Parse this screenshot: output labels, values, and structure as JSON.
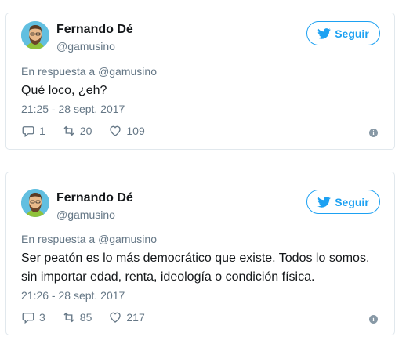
{
  "tweets": [
    {
      "author_name": "Fernando Dé",
      "author_handle": "@gamusino",
      "follow_label": "Seguir",
      "reply_prefix": "En respuesta a",
      "reply_handle": "@gamusino",
      "text": "Qué loco, ¿eh?",
      "timestamp": "21:25 - 28 sept. 2017",
      "replies": "1",
      "retweets": "20",
      "likes": "109"
    },
    {
      "author_name": "Fernando Dé",
      "author_handle": "@gamusino",
      "follow_label": "Seguir",
      "reply_prefix": "En respuesta a",
      "reply_handle": "@gamusino",
      "text": "Ser peatón es lo más democrático que existe. Todos lo somos, sin importar edad, renta, ideología o condición física.",
      "timestamp": "21:26 - 28 sept. 2017",
      "replies": "3",
      "retweets": "85",
      "likes": "217"
    }
  ],
  "colors": {
    "accent": "#1da1f2",
    "muted": "#657786",
    "border": "#e1e8ed"
  },
  "icons": [
    "avatar-illustration",
    "twitter-bird-icon",
    "reply-icon",
    "retweet-icon",
    "like-icon",
    "info-icon"
  ]
}
